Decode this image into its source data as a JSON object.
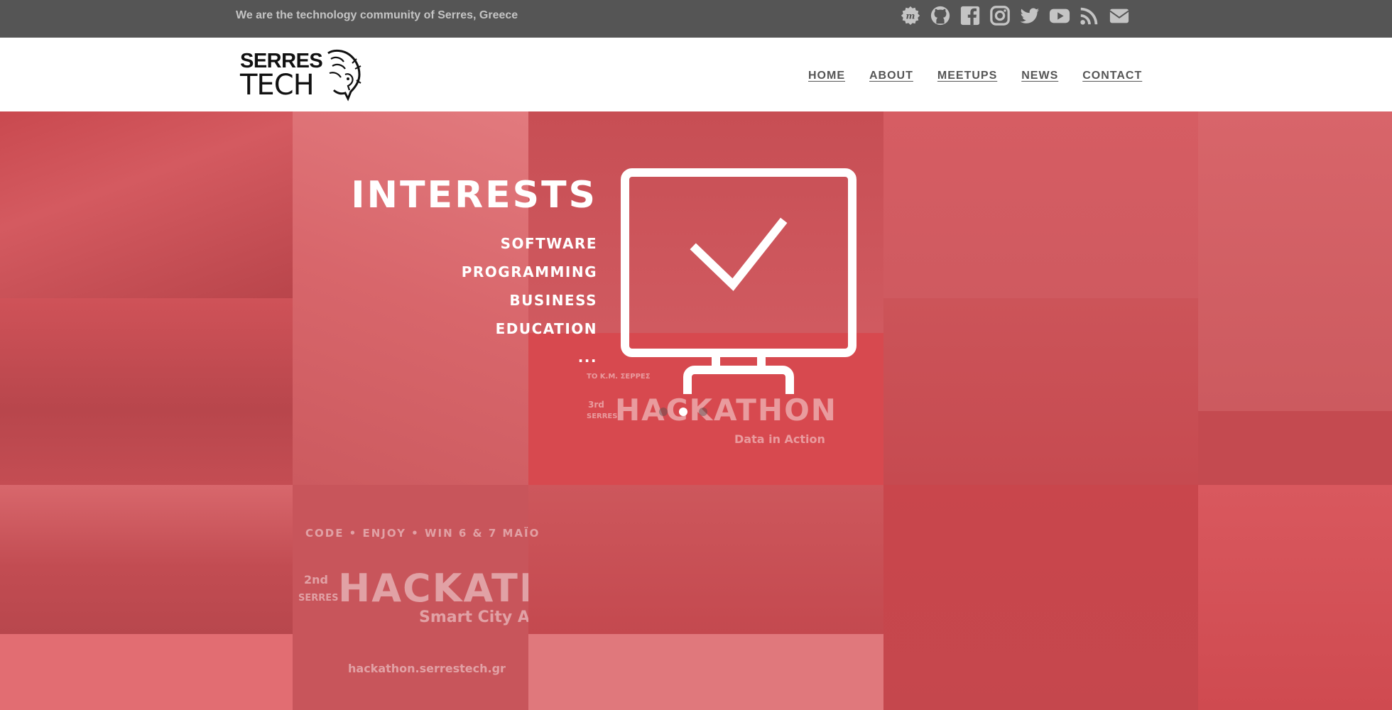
{
  "topbar": {
    "tagline": "We are the technology community of Serres, Greece",
    "social_icons": [
      "meetup-icon",
      "github-icon",
      "facebook-icon",
      "instagram-icon",
      "twitter-icon",
      "youtube-icon",
      "rss-icon",
      "email-icon"
    ]
  },
  "logo": {
    "line1": "SERRES",
    "line2": "TECH"
  },
  "nav": {
    "items": [
      "HOME",
      "ABOUT",
      "MEETUPS",
      "NEWS",
      "CONTACT"
    ]
  },
  "hero": {
    "title": "INTERESTS",
    "items": [
      "SOFTWARE",
      "PROGRAMMING",
      "BUSINESS",
      "EDUCATION",
      "..."
    ],
    "icon": "monitor-check-icon",
    "slider_active_index": 1,
    "slider_count": 3,
    "background_text": {
      "hack1_line": "CODE • ENJOY • WIN   6 & 7 ΜΑΪΟ",
      "hack1_edition": "2nd",
      "hack1_city": "SERRES",
      "hack1_title": "HACKATHON",
      "hack1_subtitle": "Smart City App",
      "hack1_url": "hackathon.serrestech.gr",
      "hack2_line": "ΤΟ Κ.Μ. ΣΕΡΡΕΣ",
      "hack2_edition": "3rd",
      "hack2_city": "SERRES",
      "hack2_title": "HACKATHON",
      "hack2_subtitle": "Data in Action"
    }
  },
  "colors": {
    "topbar": "#555555",
    "hero_red": "#d9535a",
    "white": "#ffffff"
  }
}
